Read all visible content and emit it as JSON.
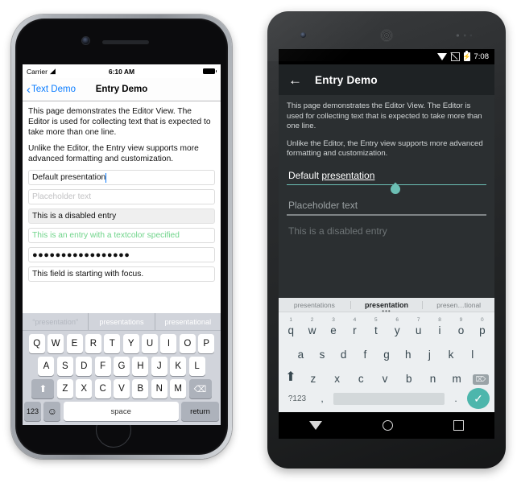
{
  "colors": {
    "ios_accent": "#0a7cff",
    "ios_green_text": "#6fd48a",
    "android_accent": "#4db6ac",
    "android_underline_active": "#6cbfb4"
  },
  "ios": {
    "status": {
      "carrier": "Carrier",
      "wifi_icon": "wifi-icon",
      "time": "6:10 AM",
      "battery_icon": "battery-full-icon"
    },
    "navbar": {
      "back_label": "Text Demo",
      "back_chevron": "‹",
      "title": "Entry Demo"
    },
    "paragraphs": [
      "This page demonstrates the Editor View. The Editor is used for collecting text that is expected to take more than one line.",
      "Unlike the Editor, the Entry view supports more advanced formatting and customization."
    ],
    "entries": [
      {
        "name": "default-presentation",
        "value": "Default presentation",
        "state": "focused-caret"
      },
      {
        "name": "placeholder-entry",
        "value": "Placeholder text",
        "state": "placeholder"
      },
      {
        "name": "disabled-entry",
        "value": "This is a disabled entry",
        "state": "disabled"
      },
      {
        "name": "colored-entry",
        "value": "This is an entry with a textcolor specified",
        "state": "colored"
      },
      {
        "name": "password-entry",
        "value": "●●●●●●●●●●●●●●●●●",
        "state": "password"
      },
      {
        "name": "focus-entry",
        "value": "This field is starting with focus.",
        "state": "normal"
      }
    ],
    "keyboard": {
      "suggestions": [
        "“presentation”",
        "presentations",
        "presentational"
      ],
      "row1": [
        "Q",
        "W",
        "E",
        "R",
        "T",
        "Y",
        "U",
        "I",
        "O",
        "P"
      ],
      "row2": [
        "A",
        "S",
        "D",
        "F",
        "G",
        "H",
        "J",
        "K",
        "L"
      ],
      "row3": [
        "Z",
        "X",
        "C",
        "V",
        "B",
        "N",
        "M"
      ],
      "shift_icon": "⬆",
      "delete_icon": "⌫",
      "numbers_label": "123",
      "emoji_icon": "☺",
      "space_label": "space",
      "return_label": "return"
    }
  },
  "android": {
    "status": {
      "wifi_icon": "wifi-icon",
      "signal_icon": "signal-off-icon",
      "battery_icon": "battery-charging-icon",
      "battery_bolt": "⚡",
      "time": "7:08"
    },
    "appbar": {
      "back_icon": "←",
      "title": "Entry Demo"
    },
    "paragraphs": [
      "This page demonstrates the Editor View. The Editor is used for collecting text that is expected to take more than one line.",
      "Unlike the Editor, the Entry view supports more advanced formatting and customization."
    ],
    "fields": [
      {
        "name": "default-presentation",
        "prefix": "Default ",
        "composing": "presentation",
        "state": "active"
      },
      {
        "name": "placeholder-entry",
        "value": "Placeholder text",
        "state": "placeholder"
      },
      {
        "name": "disabled-entry",
        "value": "This is a disabled entry",
        "state": "disabled"
      }
    ],
    "keyboard": {
      "suggestions": [
        "presentations",
        "presentation",
        "presen…tional"
      ],
      "more_dots": "•••",
      "row1": [
        "q",
        "w",
        "e",
        "r",
        "t",
        "y",
        "u",
        "i",
        "o",
        "p"
      ],
      "row1_hints": [
        "1",
        "2",
        "3",
        "4",
        "5",
        "6",
        "7",
        "8",
        "9",
        "0"
      ],
      "row2": [
        "a",
        "s",
        "d",
        "f",
        "g",
        "h",
        "j",
        "k",
        "l"
      ],
      "row3": [
        "z",
        "x",
        "c",
        "v",
        "b",
        "n",
        "m"
      ],
      "shift_icon": "⬆",
      "delete_icon": "⌦",
      "symbols_label": "?123",
      "comma_label": ",",
      "period_label": ".",
      "enter_icon": "✓"
    },
    "navbar": {
      "back_icon": "nav-back-triangle-icon",
      "home_icon": "nav-home-circle-icon",
      "recents_icon": "nav-recents-square-icon"
    }
  }
}
